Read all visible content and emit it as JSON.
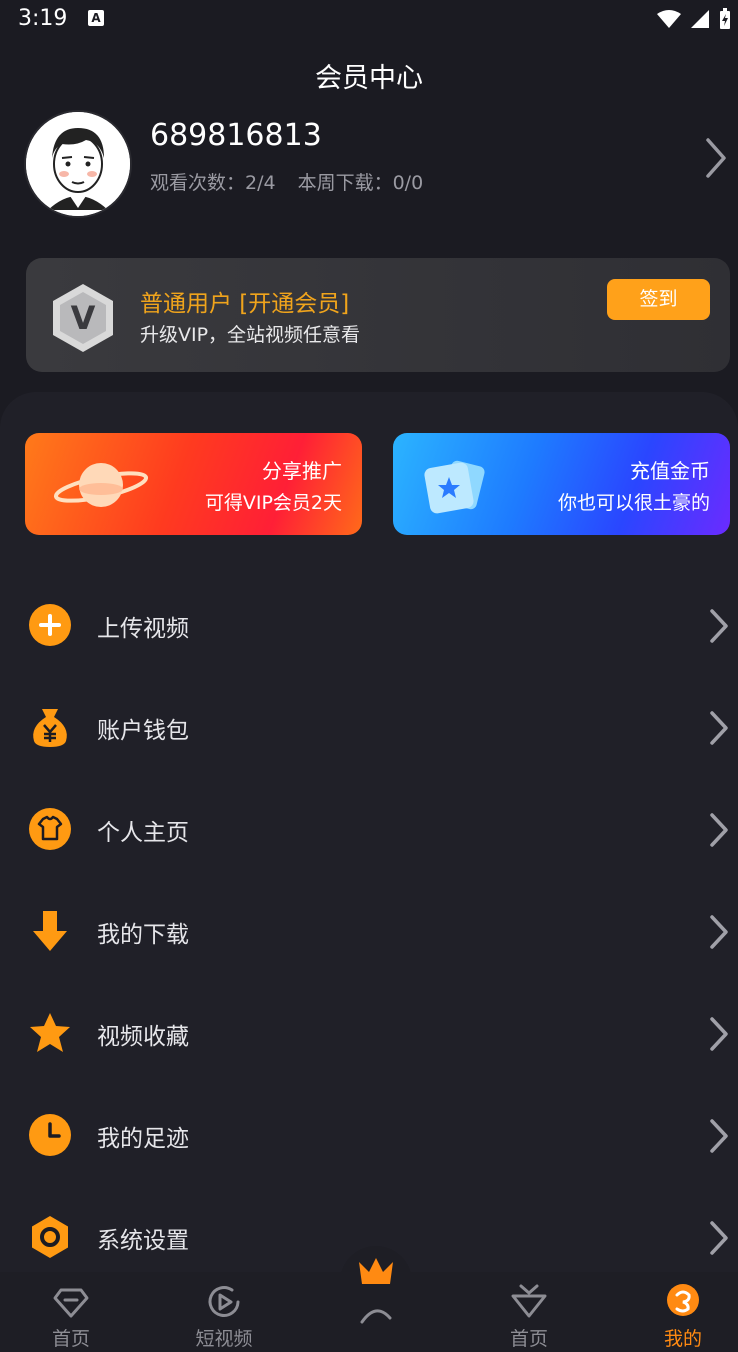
{
  "status_bar": {
    "time": "3:19",
    "a_icon": "A"
  },
  "header": {
    "title": "会员中心"
  },
  "profile": {
    "user_id": "689816813",
    "watch_count": "观看次数：2/4",
    "weekly_download": "本周下载：0/0"
  },
  "vip_card": {
    "title": "普通用户 [开通会员]",
    "subtitle": "升级VIP，全站视频任意看",
    "badge_letter": "V",
    "checkin_label": "签到"
  },
  "promos": [
    {
      "title": "分享推广",
      "subtitle": "可得VIP会员2天"
    },
    {
      "title": "充值金币",
      "subtitle": "你也可以很土豪的"
    }
  ],
  "menu": [
    {
      "label": "上传视频",
      "icon": "plus-circle-icon"
    },
    {
      "label": "账户钱包",
      "icon": "money-bag-icon"
    },
    {
      "label": "个人主页",
      "icon": "tshirt-icon"
    },
    {
      "label": "我的下载",
      "icon": "download-arrow-icon"
    },
    {
      "label": "视频收藏",
      "icon": "star-icon"
    },
    {
      "label": "我的足迹",
      "icon": "clock-icon"
    },
    {
      "label": "系统设置",
      "icon": "settings-hex-icon"
    }
  ],
  "bottom_nav": [
    {
      "label": "首页",
      "icon": "diamond-icon",
      "active": false
    },
    {
      "label": "短视频",
      "icon": "play-circle-icon",
      "active": false
    },
    {
      "label": "",
      "icon": "crown-icon",
      "active": false
    },
    {
      "label": "首页",
      "icon": "heart-tv-icon",
      "active": false
    },
    {
      "label": "我的",
      "icon": "profile-icon",
      "active": true
    }
  ],
  "colors": {
    "accent": "#ffa11a",
    "vip_gold": "#f0a41c",
    "background": "#1b1b22"
  }
}
